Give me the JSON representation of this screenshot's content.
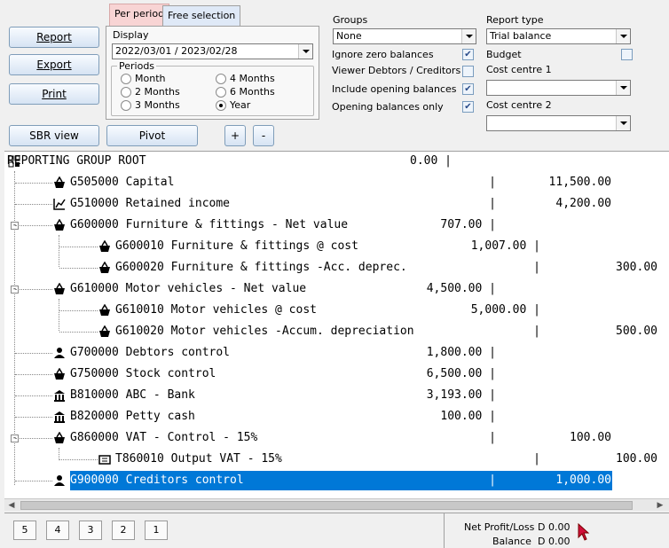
{
  "left_buttons": {
    "report": "Report",
    "export": "Export",
    "print": "Print",
    "sbr_view": "SBR view",
    "pivot": "Pivot",
    "plus": "+",
    "minus": "-"
  },
  "tabs": {
    "per_period": "Per period",
    "free_selection": "Free selection"
  },
  "display": {
    "label": "Display",
    "date_range": "2022/03/01 / 2023/02/28",
    "periods_label": "Periods",
    "options": [
      "Month",
      "2 Months",
      "3 Months",
      "4 Months",
      "6 Months",
      "Year"
    ],
    "selected": "Year"
  },
  "groups": {
    "label": "Groups",
    "value": "None"
  },
  "options": {
    "ignore_zero": "Ignore zero balances",
    "viewer_dc": "Viewer  Debtors / Creditors",
    "include_opening": "Include opening balances",
    "opening_only": "Opening balances only",
    "budget": "Budget"
  },
  "checks": {
    "ignore_zero": true,
    "viewer_dc": false,
    "include_opening": true,
    "opening_only": true,
    "budget": false
  },
  "report_type": {
    "label": "Report type",
    "value": "Trial balance"
  },
  "cost_centre_1": {
    "label": "Cost centre 1",
    "value": ""
  },
  "cost_centre_2": {
    "label": "Cost centre 2",
    "value": ""
  },
  "tree": [
    {
      "code": "REPORTING GROUP ROOT",
      "icon": "group-icon",
      "a": "0.00 |",
      "b": "",
      "c": ""
    },
    {
      "code": "G505000 Capital",
      "icon": "basket-icon",
      "a": "|",
      "b": "11,500.00",
      "c": ""
    },
    {
      "code": "G510000 Retained income",
      "icon": "chart-icon",
      "a": "|",
      "b": "4,200.00",
      "c": ""
    },
    {
      "code": "G600000 Furniture & fittings - Net value",
      "icon": "basket-icon",
      "a": "707.00 |",
      "b": "",
      "c": ""
    },
    {
      "code": "G600010 Furniture & fittings @ cost",
      "icon": "basket-icon",
      "a": "1,007.00 |",
      "b": "",
      "c": ""
    },
    {
      "code": "G600020 Furniture & fittings -Acc. deprec.",
      "icon": "basket-icon",
      "a": "|",
      "b": "",
      "c": "300.00"
    },
    {
      "code": "G610000 Motor vehicles - Net value",
      "icon": "basket-icon",
      "a": "4,500.00 |",
      "b": "",
      "c": ""
    },
    {
      "code": "G610010 Motor vehicles @ cost",
      "icon": "basket-icon",
      "a": "5,000.00 |",
      "b": "",
      "c": ""
    },
    {
      "code": "G610020 Motor vehicles -Accum. depreciation",
      "icon": "basket-icon",
      "a": "|",
      "b": "",
      "c": "500.00"
    },
    {
      "code": "G700000 Debtors control",
      "icon": "person-icon",
      "a": "1,800.00 |",
      "b": "",
      "c": ""
    },
    {
      "code": "G750000 Stock control",
      "icon": "basket-icon",
      "a": "6,500.00 |",
      "b": "",
      "c": ""
    },
    {
      "code": "B810000 ABC - Bank",
      "icon": "bank-icon",
      "a": "3,193.00 |",
      "b": "",
      "c": ""
    },
    {
      "code": "B820000 Petty cash",
      "icon": "bank-icon",
      "a": "100.00 |",
      "b": "",
      "c": ""
    },
    {
      "code": "G860000 VAT - Control - 15%",
      "icon": "basket-icon",
      "a": "|",
      "b": "100.00",
      "c": ""
    },
    {
      "code": "T860010 Output VAT - 15%",
      "icon": "ticket-icon",
      "a": "|",
      "b": "",
      "c": "100.00"
    },
    {
      "code": "G900000 Creditors control",
      "icon": "person-icon",
      "a": "|",
      "b": "1,000.00",
      "c": ""
    }
  ],
  "levels": [
    "5",
    "4",
    "3",
    "2",
    "1"
  ],
  "summary": {
    "net_label": "Net Profit/Loss",
    "net_value": "D 0.00",
    "balance_label": "Balance",
    "balance_value": "D 0.00"
  }
}
